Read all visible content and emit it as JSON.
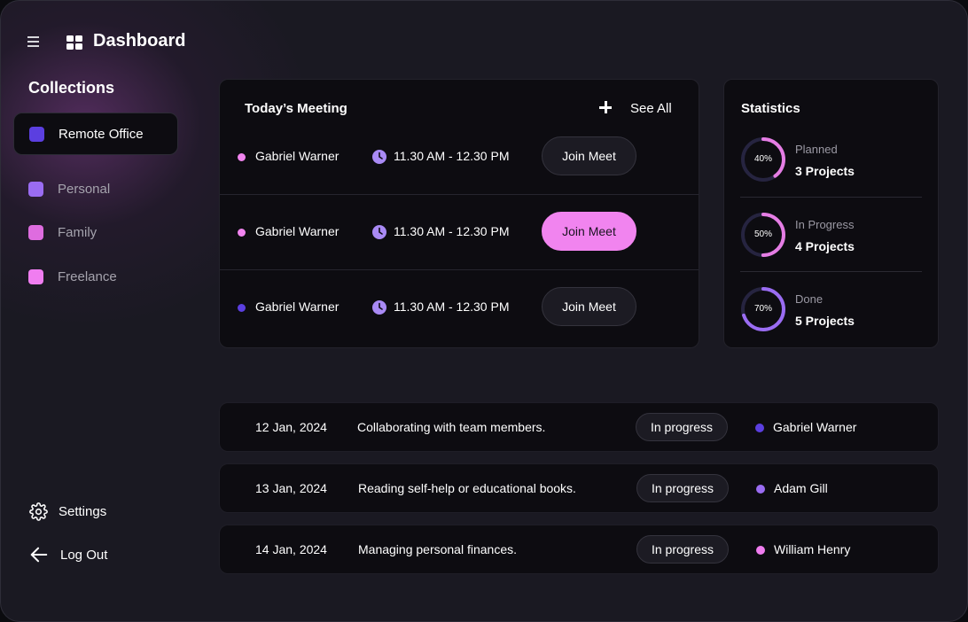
{
  "header": {
    "title": "Dashboard"
  },
  "sidebar": {
    "collections_title": "Collections",
    "items": [
      {
        "label": "Remote Office",
        "color": "#5b3fe0"
      },
      {
        "label": "Personal",
        "color": "#9a6cf2"
      },
      {
        "label": "Family",
        "color": "#de6cdf"
      },
      {
        "label": "Freelance",
        "color": "#f07df0"
      }
    ],
    "settings_label": "Settings",
    "logout_label": "Log Out"
  },
  "meetings": {
    "title": "Today’s Meeting",
    "see_all": "See All",
    "rows": [
      {
        "name": "Gabriel Warner",
        "time": "11.30 AM - 12.30 PM",
        "button": "Join Meet",
        "dot_color": "#f184ef",
        "highlighted": false
      },
      {
        "name": "Gabriel Warner",
        "time": "11.30 AM - 12.30 PM",
        "button": "Join Meet",
        "dot_color": "#f184ef",
        "highlighted": true
      },
      {
        "name": "Gabriel Warner",
        "time": "11.30 AM - 12.30 PM",
        "button": "Join Meet",
        "dot_color": "#5b3fe0",
        "highlighted": false
      }
    ]
  },
  "statistics": {
    "title": "Statistics",
    "items": [
      {
        "percent": "40%",
        "progress": 0.4,
        "label": "Planned",
        "count": "3 Projects",
        "color": "#e57de4"
      },
      {
        "percent": "50%",
        "progress": 0.5,
        "label": "In Progress",
        "count": "4 Projects",
        "color": "#e57de4"
      },
      {
        "percent": "70%",
        "progress": 0.7,
        "label": "Done",
        "count": "5 Projects",
        "color": "#9a6cf2"
      }
    ]
  },
  "tasks": [
    {
      "date": "12 Jan, 2024",
      "description": "Collaborating with team members.",
      "status": "In progress",
      "assignee": "Gabriel Warner",
      "dot_color": "#5b3fe0"
    },
    {
      "date": "13 Jan, 2024",
      "description": "Reading self-help or educational books.",
      "status": "In progress",
      "assignee": "Adam Gill",
      "dot_color": "#9a6cf2"
    },
    {
      "date": "14 Jan, 2024",
      "description": "Managing personal finances.",
      "status": "In progress",
      "assignee": "William Henry",
      "dot_color": "#f07df0"
    }
  ]
}
